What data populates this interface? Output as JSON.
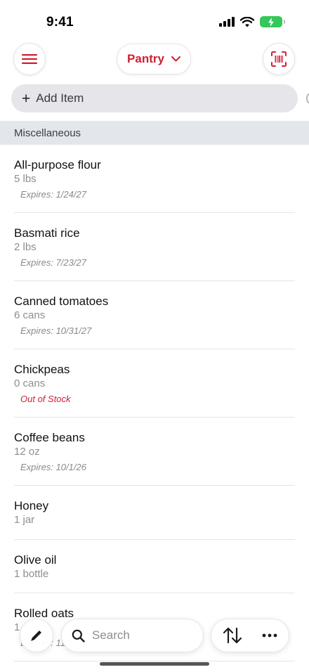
{
  "status": {
    "time": "9:41"
  },
  "toolbar": {
    "menu_icon": "menu-icon",
    "pantry_label": "Pantry",
    "scan_icon": "barcode-scan-icon",
    "accent_color": "#cf1f35"
  },
  "add_item": {
    "label": "Add Item"
  },
  "section": {
    "title": "Miscellaneous"
  },
  "items": [
    {
      "name": "All-purpose flour",
      "qty": "5 lbs",
      "note": "Expires: 1/24/27"
    },
    {
      "name": "Basmati rice",
      "qty": "2 lbs",
      "note": "Expires: 7/23/27"
    },
    {
      "name": "Canned tomatoes",
      "qty": "6 cans",
      "note": "Expires: 10/31/27"
    },
    {
      "name": "Chickpeas",
      "qty": "0 cans",
      "note": "Out of Stock"
    },
    {
      "name": "Coffee beans",
      "qty": "12 oz",
      "note": "Expires: 10/1/26"
    },
    {
      "name": "Honey",
      "qty": "1 jar",
      "note": ""
    },
    {
      "name": "Olive oil",
      "qty": "1 bottle",
      "note": ""
    },
    {
      "name": "Rolled oats",
      "qty": "1",
      "note": "Expires: 11/"
    }
  ],
  "bottom_bar": {
    "search_placeholder": "Search",
    "edit_icon": "pencil-icon",
    "sort_icon": "sort-arrows-icon",
    "more_icon": "more-icon"
  }
}
